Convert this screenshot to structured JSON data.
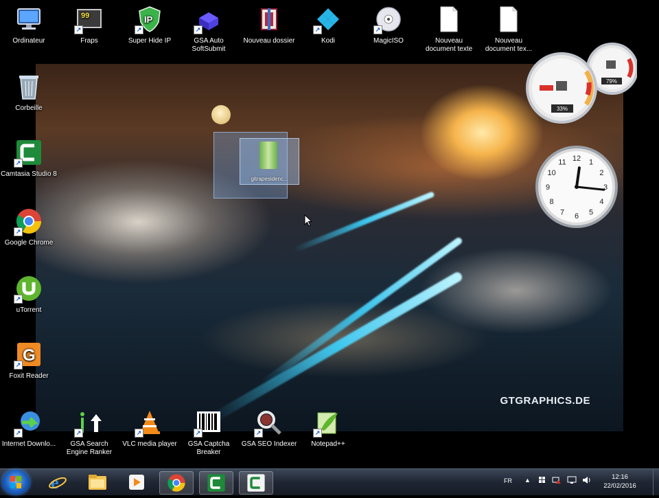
{
  "desktop": {
    "wallpaper_watermark": "GTGRAPHICS.DE",
    "icons_top": [
      {
        "label": "Ordinateur",
        "icon": "computer-icon"
      },
      {
        "label": "Fraps",
        "icon": "fraps-icon",
        "badge": "99"
      },
      {
        "label": "Super Hide IP",
        "icon": "super-hide-ip-icon",
        "badge": "IP"
      },
      {
        "label": "GSA Auto SoftSubmit",
        "icon": "gsa-auto-softsubmit-icon"
      },
      {
        "label": "Nouveau dossier",
        "icon": "winrar-folder-icon"
      },
      {
        "label": "Kodi",
        "icon": "kodi-icon"
      },
      {
        "label": "MagicISO",
        "icon": "magiciso-icon"
      },
      {
        "label": "Nouveau document texte",
        "icon": "text-document-icon"
      },
      {
        "label": "Nouveau document tex...",
        "icon": "text-document-icon"
      }
    ],
    "icons_left": [
      {
        "label": "Corbeille",
        "icon": "recycle-bin-icon"
      },
      {
        "label": "Camtasia Studio 8",
        "icon": "camtasia-icon"
      },
      {
        "label": "Google Chrome",
        "icon": "chrome-icon"
      },
      {
        "label": "uTorrent",
        "icon": "utorrent-icon"
      },
      {
        "label": "Foxit Reader",
        "icon": "foxit-reader-icon"
      }
    ],
    "icons_bottom": [
      {
        "label": "Internet Downlo...",
        "icon": "internet-download-manager-icon"
      },
      {
        "label": "GSA Search Engine Ranker",
        "icon": "gsa-search-engine-ranker-icon"
      },
      {
        "label": "VLC media player",
        "icon": "vlc-icon"
      },
      {
        "label": "GSA Captcha Breaker",
        "icon": "gsa-captcha-breaker-icon"
      },
      {
        "label": "GSA SEO Indexer",
        "icon": "gsa-seo-indexer-icon"
      },
      {
        "label": "Notepad++",
        "icon": "notepad-plus-plus-icon"
      }
    ],
    "dragged_item": {
      "label": "gitrapesidenc...",
      "icon": "archive-file-icon"
    }
  },
  "gadgets": {
    "cpu_meter": {
      "cpu_percent": "33%",
      "ram_percent": "79%",
      "cpu_value": 0.33,
      "ram_value": 0.79
    },
    "clock": {
      "hour": 12,
      "minute": 16
    }
  },
  "taskbar": {
    "apps": [
      {
        "name": "internet-explorer-icon",
        "active": false
      },
      {
        "name": "file-explorer-icon",
        "active": false
      },
      {
        "name": "media-player-icon",
        "active": false
      },
      {
        "name": "chrome-icon",
        "active": true
      },
      {
        "name": "camtasia-icon",
        "active": true
      },
      {
        "name": "camtasia-recorder-icon",
        "active": true
      }
    ],
    "tray": {
      "language": "FR",
      "time": "12:16",
      "date": "22/02/2016"
    }
  },
  "colors": {
    "taskbar": "#1f2633",
    "beam": "#3cd2ff",
    "gadget_red": "#d9322b"
  }
}
